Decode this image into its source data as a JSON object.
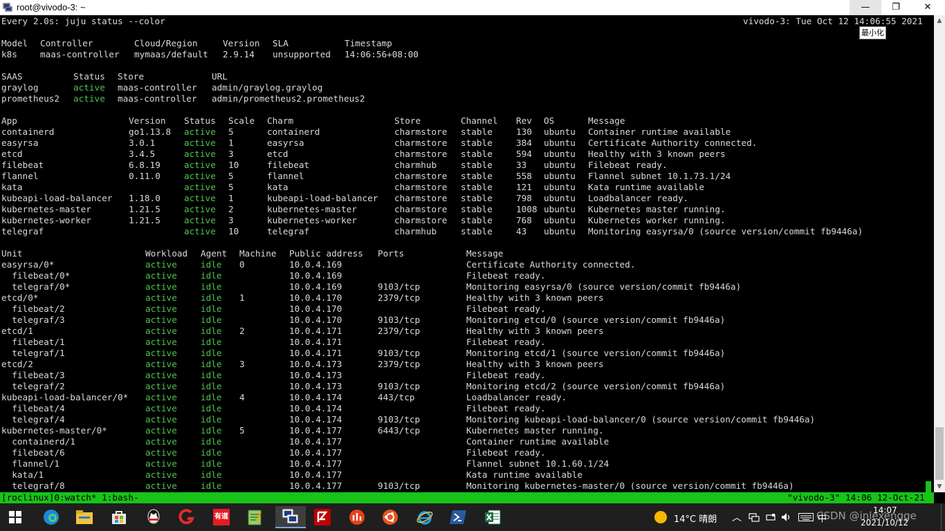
{
  "window": {
    "title": "root@vivodo-3: ~",
    "tooltip": "最小化",
    "min_glyph": "—",
    "max_glyph": "❐",
    "close_glyph": "✕"
  },
  "header": {
    "left": "Every 2.0s: juju status --color",
    "right": "vivodo-3: Tue Oct 12 14:06:55 2021"
  },
  "model": {
    "headers": [
      "Model",
      "Controller",
      "Cloud/Region",
      "Version",
      "SLA",
      "Timestamp"
    ],
    "row": [
      "k8s",
      "maas-controller",
      "mymaas/default",
      "2.9.14",
      "unsupported",
      "14:06:56+08:00"
    ]
  },
  "saas": {
    "headers": [
      "SAAS",
      "Status",
      "Store",
      "URL"
    ],
    "rows": [
      [
        "graylog",
        "active",
        "maas-controller",
        "admin/graylog.graylog"
      ],
      [
        "prometheus2",
        "active",
        "maas-controller",
        "admin/prometheus2.prometheus2"
      ]
    ]
  },
  "apps": {
    "headers": [
      "App",
      "Version",
      "Status",
      "Scale",
      "Charm",
      "Store",
      "Channel",
      "Rev",
      "OS",
      "Message"
    ],
    "rows": [
      [
        "containerd",
        "go1.13.8",
        "active",
        "5",
        "containerd",
        "charmstore",
        "stable",
        "130",
        "ubuntu",
        "Container runtime available"
      ],
      [
        "easyrsa",
        "3.0.1",
        "active",
        "1",
        "easyrsa",
        "charmstore",
        "stable",
        "384",
        "ubuntu",
        "Certificate Authority connected."
      ],
      [
        "etcd",
        "3.4.5",
        "active",
        "3",
        "etcd",
        "charmstore",
        "stable",
        "594",
        "ubuntu",
        "Healthy with 3 known peers"
      ],
      [
        "filebeat",
        "6.8.19",
        "active",
        "10",
        "filebeat",
        "charmhub",
        "stable",
        "33",
        "ubuntu",
        "Filebeat ready."
      ],
      [
        "flannel",
        "0.11.0",
        "active",
        "5",
        "flannel",
        "charmstore",
        "stable",
        "558",
        "ubuntu",
        "Flannel subnet 10.1.73.1/24"
      ],
      [
        "kata",
        "",
        "active",
        "5",
        "kata",
        "charmstore",
        "stable",
        "121",
        "ubuntu",
        "Kata runtime available"
      ],
      [
        "kubeapi-load-balancer",
        "1.18.0",
        "active",
        "1",
        "kubeapi-load-balancer",
        "charmstore",
        "stable",
        "798",
        "ubuntu",
        "Loadbalancer ready."
      ],
      [
        "kubernetes-master",
        "1.21.5",
        "active",
        "2",
        "kubernetes-master",
        "charmstore",
        "stable",
        "1008",
        "ubuntu",
        "Kubernetes master running."
      ],
      [
        "kubernetes-worker",
        "1.21.5",
        "active",
        "3",
        "kubernetes-worker",
        "charmstore",
        "stable",
        "768",
        "ubuntu",
        "Kubernetes worker running."
      ],
      [
        "telegraf",
        "",
        "active",
        "10",
        "telegraf",
        "charmhub",
        "stable",
        "43",
        "ubuntu",
        "Monitoring easyrsa/0 (source version/commit fb9446a)"
      ]
    ]
  },
  "units": {
    "headers": [
      "Unit",
      "Workload",
      "Agent",
      "Machine",
      "Public address",
      "Ports",
      "Message"
    ],
    "rows": [
      [
        "easyrsa/0*",
        "active",
        "idle",
        "0",
        "10.0.4.169",
        "",
        "Certificate Authority connected."
      ],
      [
        "  filebeat/0*",
        "active",
        "idle",
        "",
        "10.0.4.169",
        "",
        "Filebeat ready."
      ],
      [
        "  telegraf/0*",
        "active",
        "idle",
        "",
        "10.0.4.169",
        "9103/tcp",
        "Monitoring easyrsa/0 (source version/commit fb9446a)"
      ],
      [
        "etcd/0*",
        "active",
        "idle",
        "1",
        "10.0.4.170",
        "2379/tcp",
        "Healthy with 3 known peers"
      ],
      [
        "  filebeat/2",
        "active",
        "idle",
        "",
        "10.0.4.170",
        "",
        "Filebeat ready."
      ],
      [
        "  telegraf/3",
        "active",
        "idle",
        "",
        "10.0.4.170",
        "9103/tcp",
        "Monitoring etcd/0 (source version/commit fb9446a)"
      ],
      [
        "etcd/1",
        "active",
        "idle",
        "2",
        "10.0.4.171",
        "2379/tcp",
        "Healthy with 3 known peers"
      ],
      [
        "  filebeat/1",
        "active",
        "idle",
        "",
        "10.0.4.171",
        "",
        "Filebeat ready."
      ],
      [
        "  telegraf/1",
        "active",
        "idle",
        "",
        "10.0.4.171",
        "9103/tcp",
        "Monitoring etcd/1 (source version/commit fb9446a)"
      ],
      [
        "etcd/2",
        "active",
        "idle",
        "3",
        "10.0.4.173",
        "2379/tcp",
        "Healthy with 3 known peers"
      ],
      [
        "  filebeat/3",
        "active",
        "idle",
        "",
        "10.0.4.173",
        "",
        "Filebeat ready."
      ],
      [
        "  telegraf/2",
        "active",
        "idle",
        "",
        "10.0.4.173",
        "9103/tcp",
        "Monitoring etcd/2 (source version/commit fb9446a)"
      ],
      [
        "kubeapi-load-balancer/0*",
        "active",
        "idle",
        "4",
        "10.0.4.174",
        "443/tcp",
        "Loadbalancer ready."
      ],
      [
        "  filebeat/4",
        "active",
        "idle",
        "",
        "10.0.4.174",
        "",
        "Filebeat ready."
      ],
      [
        "  telegraf/4",
        "active",
        "idle",
        "",
        "10.0.4.174",
        "9103/tcp",
        "Monitoring kubeapi-load-balancer/0 (source version/commit fb9446a)"
      ],
      [
        "kubernetes-master/0*",
        "active",
        "idle",
        "5",
        "10.0.4.177",
        "6443/tcp",
        "Kubernetes master running."
      ],
      [
        "  containerd/1",
        "active",
        "idle",
        "",
        "10.0.4.177",
        "",
        "Container runtime available"
      ],
      [
        "  filebeat/6",
        "active",
        "idle",
        "",
        "10.0.4.177",
        "",
        "Filebeat ready."
      ],
      [
        "  flannel/1",
        "active",
        "idle",
        "",
        "10.0.4.177",
        "",
        "Flannel subnet 10.1.60.1/24"
      ],
      [
        "  kata/1",
        "active",
        "idle",
        "",
        "10.0.4.177",
        "",
        "Kata runtime available"
      ],
      [
        "  telegraf/8",
        "active",
        "idle",
        "",
        "10.0.4.177",
        "9103/tcp",
        "Monitoring kubernetes-master/0 (source version/commit fb9446a)"
      ]
    ]
  },
  "tmux": {
    "left": "[roclinux]0:watch* 1:bash-",
    "right": "\"vivodo-3\" 14:06 12-Oct-21"
  },
  "colors": {
    "active": "#4fc14f",
    "status_bar": "#17c417",
    "taskbar": "#1f1f1f"
  },
  "taskbar": {
    "apps": [
      "windows-start-icon",
      "edge-icon",
      "file-explorer-icon",
      "store-icon",
      "qq-icon",
      "netease-red-icon",
      "youdao-icon",
      "notepad-icon",
      "putty-icon",
      "filezilla-icon",
      "red-app-icon",
      "ubuntu-icon",
      "internet-explorer-icon",
      "powershell-icon",
      "excel-icon"
    ],
    "youdao_label": "有道",
    "weather": "14°C 晴朗",
    "ime": "中",
    "time": "14:07",
    "date": "2021/10/12",
    "watermark": "CSDN @inlexengge"
  }
}
